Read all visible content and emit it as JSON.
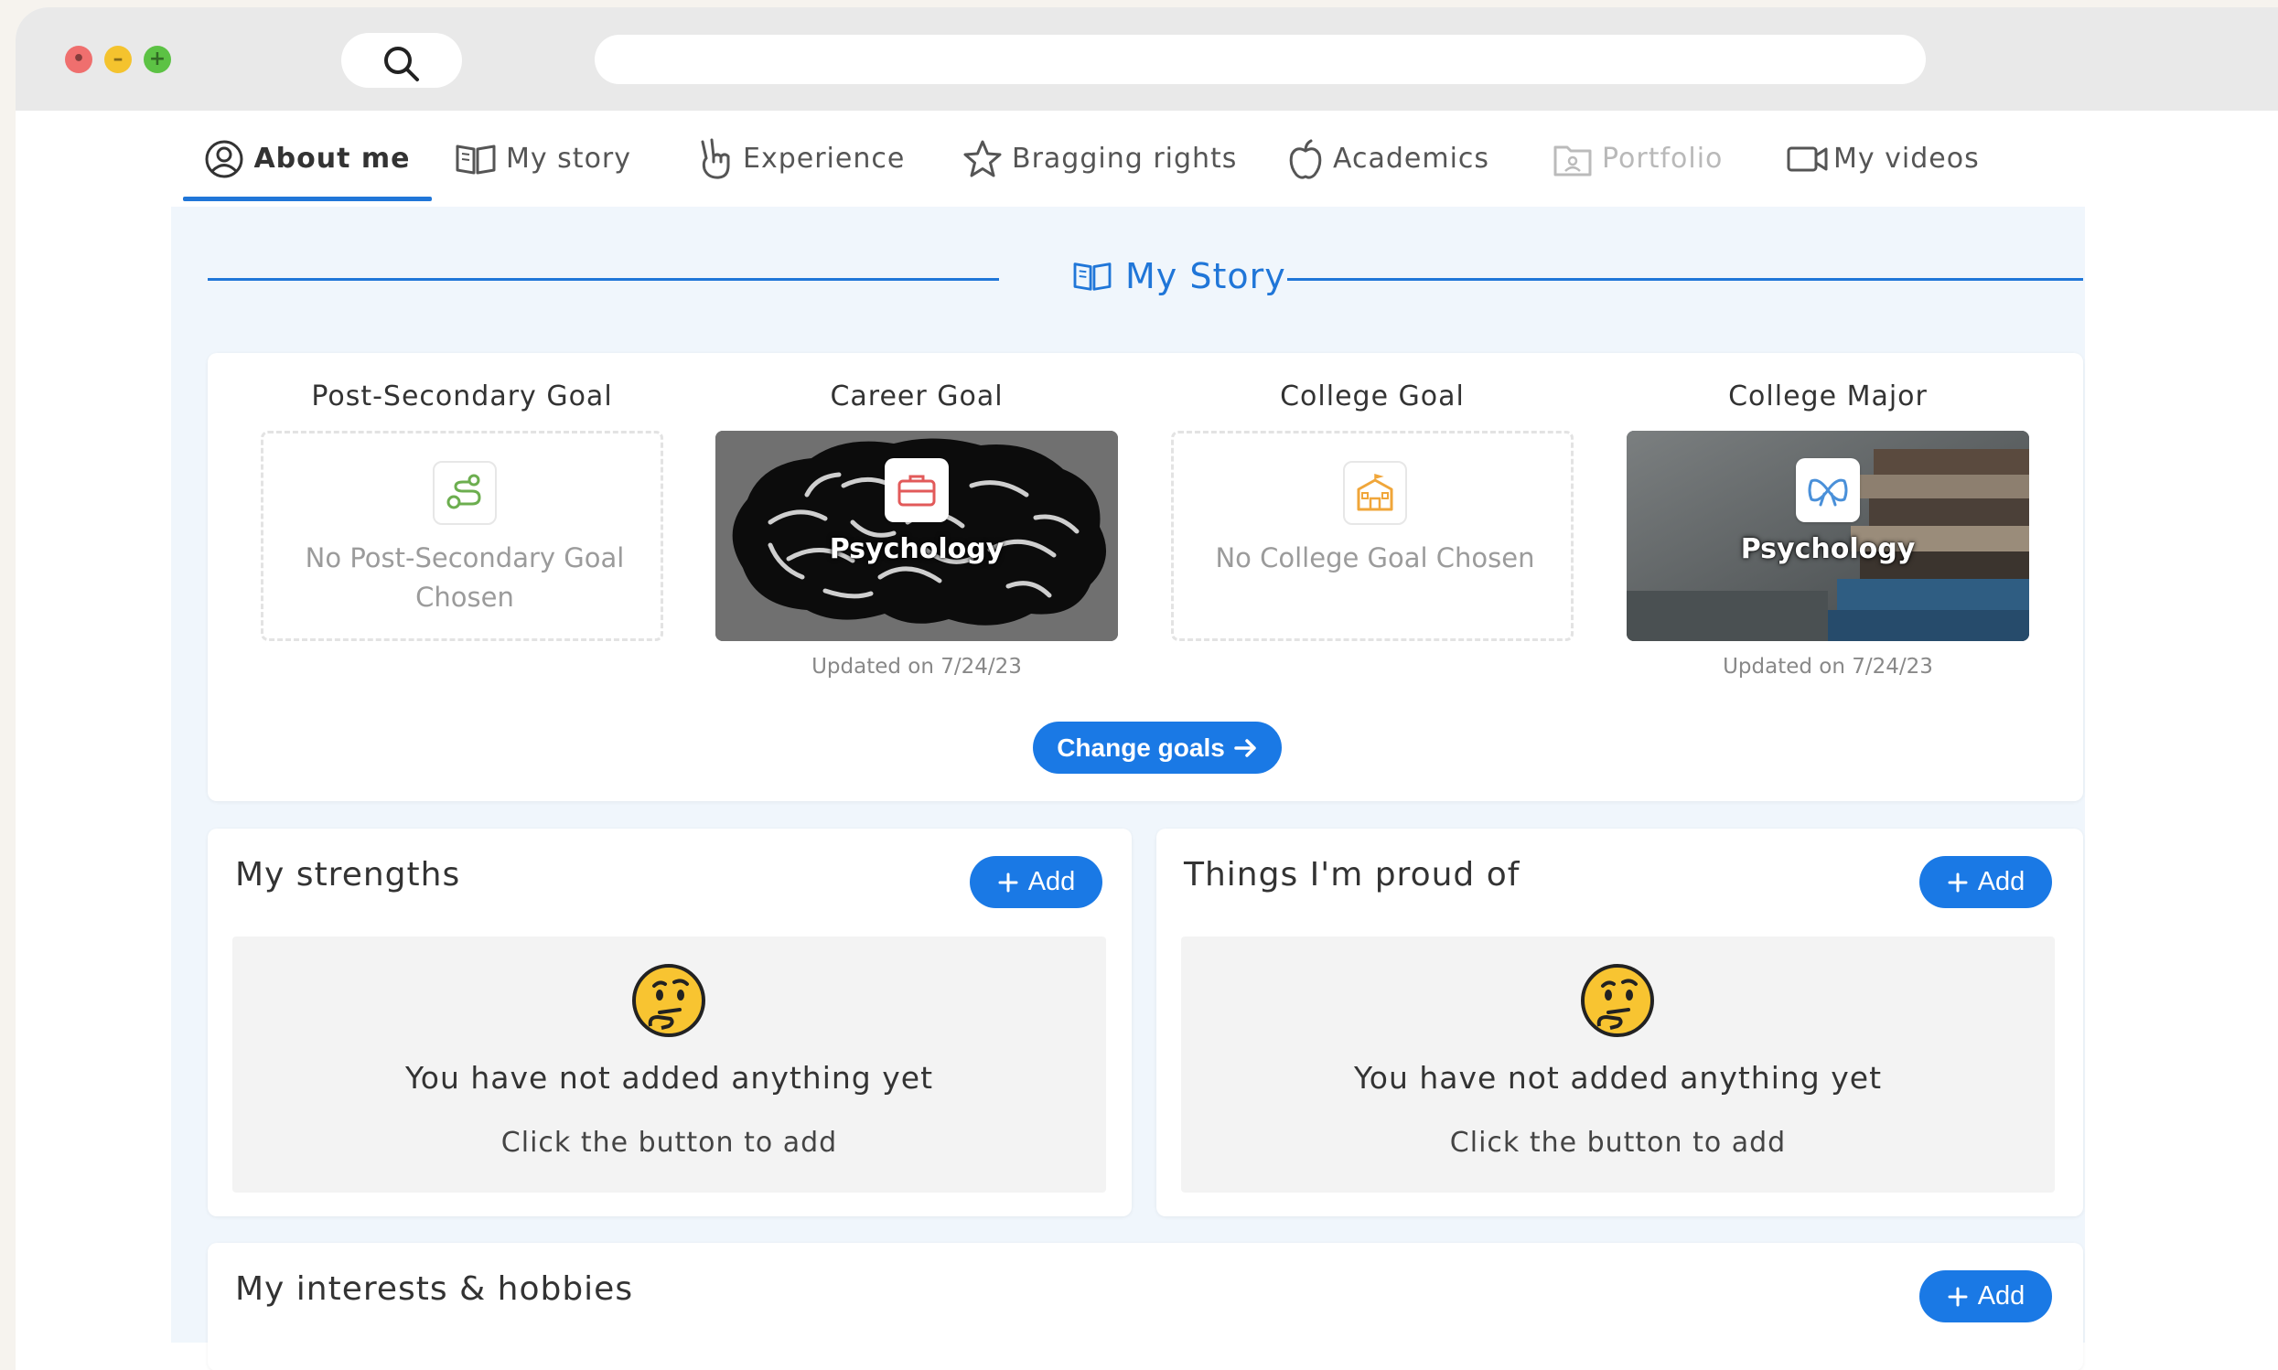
{
  "tabs": [
    {
      "label": "About me",
      "icon": "user-circle-icon",
      "state": "active"
    },
    {
      "label": "My story",
      "icon": "book-icon",
      "state": "default"
    },
    {
      "label": "Experience",
      "icon": "peace-hand-icon",
      "state": "default"
    },
    {
      "label": "Bragging rights",
      "icon": "star-icon",
      "state": "default"
    },
    {
      "label": "Academics",
      "icon": "apple-icon",
      "state": "default"
    },
    {
      "label": "Portfolio",
      "icon": "portfolio-icon",
      "state": "disabled"
    },
    {
      "label": "My videos",
      "icon": "video-camera-icon",
      "state": "default"
    }
  ],
  "section": {
    "title": "My Story",
    "icon": "book-icon"
  },
  "goals": [
    {
      "title": "Post-Secondary Goal",
      "empty_text": "No Post-Secondary Goal Chosen",
      "icon": "route-icon",
      "icon_color": "#6cae4f"
    },
    {
      "title": "Career Goal",
      "value": "Psychology",
      "updated": "Updated on 7/24/23",
      "icon": "briefcase-icon",
      "icon_color": "#e25a5a"
    },
    {
      "title": "College Goal",
      "empty_text": "No College Goal Chosen",
      "icon": "school-icon",
      "icon_color": "#f0a63a"
    },
    {
      "title": "College Major",
      "value": "Psychology",
      "updated": "Updated on 7/24/23",
      "icon": "ribbon-icon",
      "icon_color": "#4a90d9"
    }
  ],
  "change_goals_label": "Change goals",
  "strengths": {
    "title": "My strengths",
    "add_label": "Add",
    "empty_title": "You have not added anything yet",
    "empty_hint": "Click the button to add"
  },
  "proud": {
    "title": "Things I'm proud of",
    "add_label": "Add",
    "empty_title": "You have not added anything yet",
    "empty_hint": "Click the button to add"
  },
  "interests": {
    "title": "My interests & hobbies",
    "add_label": "Add"
  },
  "colors": {
    "accent": "#1a79e5",
    "panel_bg": "#f0f6fc"
  }
}
